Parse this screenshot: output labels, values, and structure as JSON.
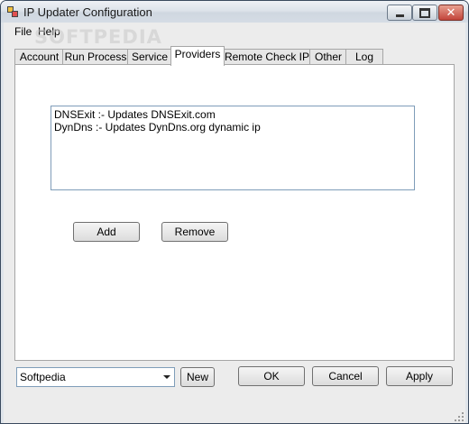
{
  "window": {
    "title": "IP Updater Configuration"
  },
  "menu": {
    "file": "File",
    "help": "Help"
  },
  "watermark": "SOFTPEDIA",
  "tabs": [
    "Account",
    "Run Process",
    "Service",
    "Providers",
    "Remote Check IP",
    "Other",
    "Log"
  ],
  "active_tab": "Providers",
  "providers": {
    "items": [
      "DNSExit :- Updates DNSExit.com",
      "DynDns :- Updates DynDns.org dynamic ip"
    ],
    "add_label": "Add",
    "remove_label": "Remove"
  },
  "footer": {
    "profile_value": "Softpedia",
    "new_label": "New",
    "ok_label": "OK",
    "cancel_label": "Cancel",
    "apply_label": "Apply"
  },
  "colors": {
    "list_border": "#7f9db9",
    "close_button": "#c2443a"
  }
}
